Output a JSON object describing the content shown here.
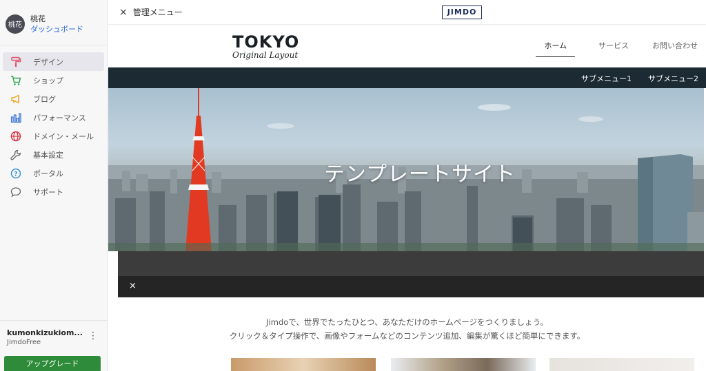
{
  "sidebar": {
    "avatar_text": "桃花",
    "user_name": "桃花",
    "dashboard": "ダッシュボード",
    "items": [
      {
        "label": "デザイン",
        "icon": "paint-roller-icon",
        "color": "#e0566f"
      },
      {
        "label": "ショップ",
        "icon": "cart-icon",
        "color": "#2fa84f"
      },
      {
        "label": "ブログ",
        "icon": "megaphone-icon",
        "color": "#f0a21b"
      },
      {
        "label": "パフォーマンス",
        "icon": "bar-chart-icon",
        "color": "#2f6bd8"
      },
      {
        "label": "ドメイン・メール",
        "icon": "globe-icon",
        "color": "#d8303c"
      },
      {
        "label": "基本設定",
        "icon": "wrench-icon",
        "color": "#666666"
      },
      {
        "label": "ポータル",
        "icon": "help-circle-icon",
        "color": "#2f8fd8"
      },
      {
        "label": "サポート",
        "icon": "chat-bubble-icon",
        "color": "#666666"
      }
    ],
    "account_name": "kumonkizukiom...",
    "account_plan": "JimdoFree",
    "more": "⋮",
    "upgrade": "アップグレード"
  },
  "topbar": {
    "close_label": "管理メニュー",
    "close_icon": "×",
    "logo": "JIMDO"
  },
  "site": {
    "brand_title": "TOKYO",
    "brand_subtitle": "Original Layout",
    "nav": [
      "ホーム",
      "サービス",
      "お問い合わせ"
    ],
    "subnav": [
      "サブメニュー1",
      "サブメニュー2"
    ],
    "hero_title": "テンプレートサイト",
    "overlay_close": "×",
    "intro_line1": "Jimdoで、世界でたったひとつ、あなただけのホームページをつくりましょう。",
    "intro_line2": "クリック＆タイプ操作で、画像やフォームなどのコンテンツ追加、編集が驚くほど簡単にできます。"
  },
  "colors": {
    "accent_link": "#2f6bd8",
    "upgrade_green": "#2e8b39",
    "subnav_bg": "#1c2a33"
  }
}
